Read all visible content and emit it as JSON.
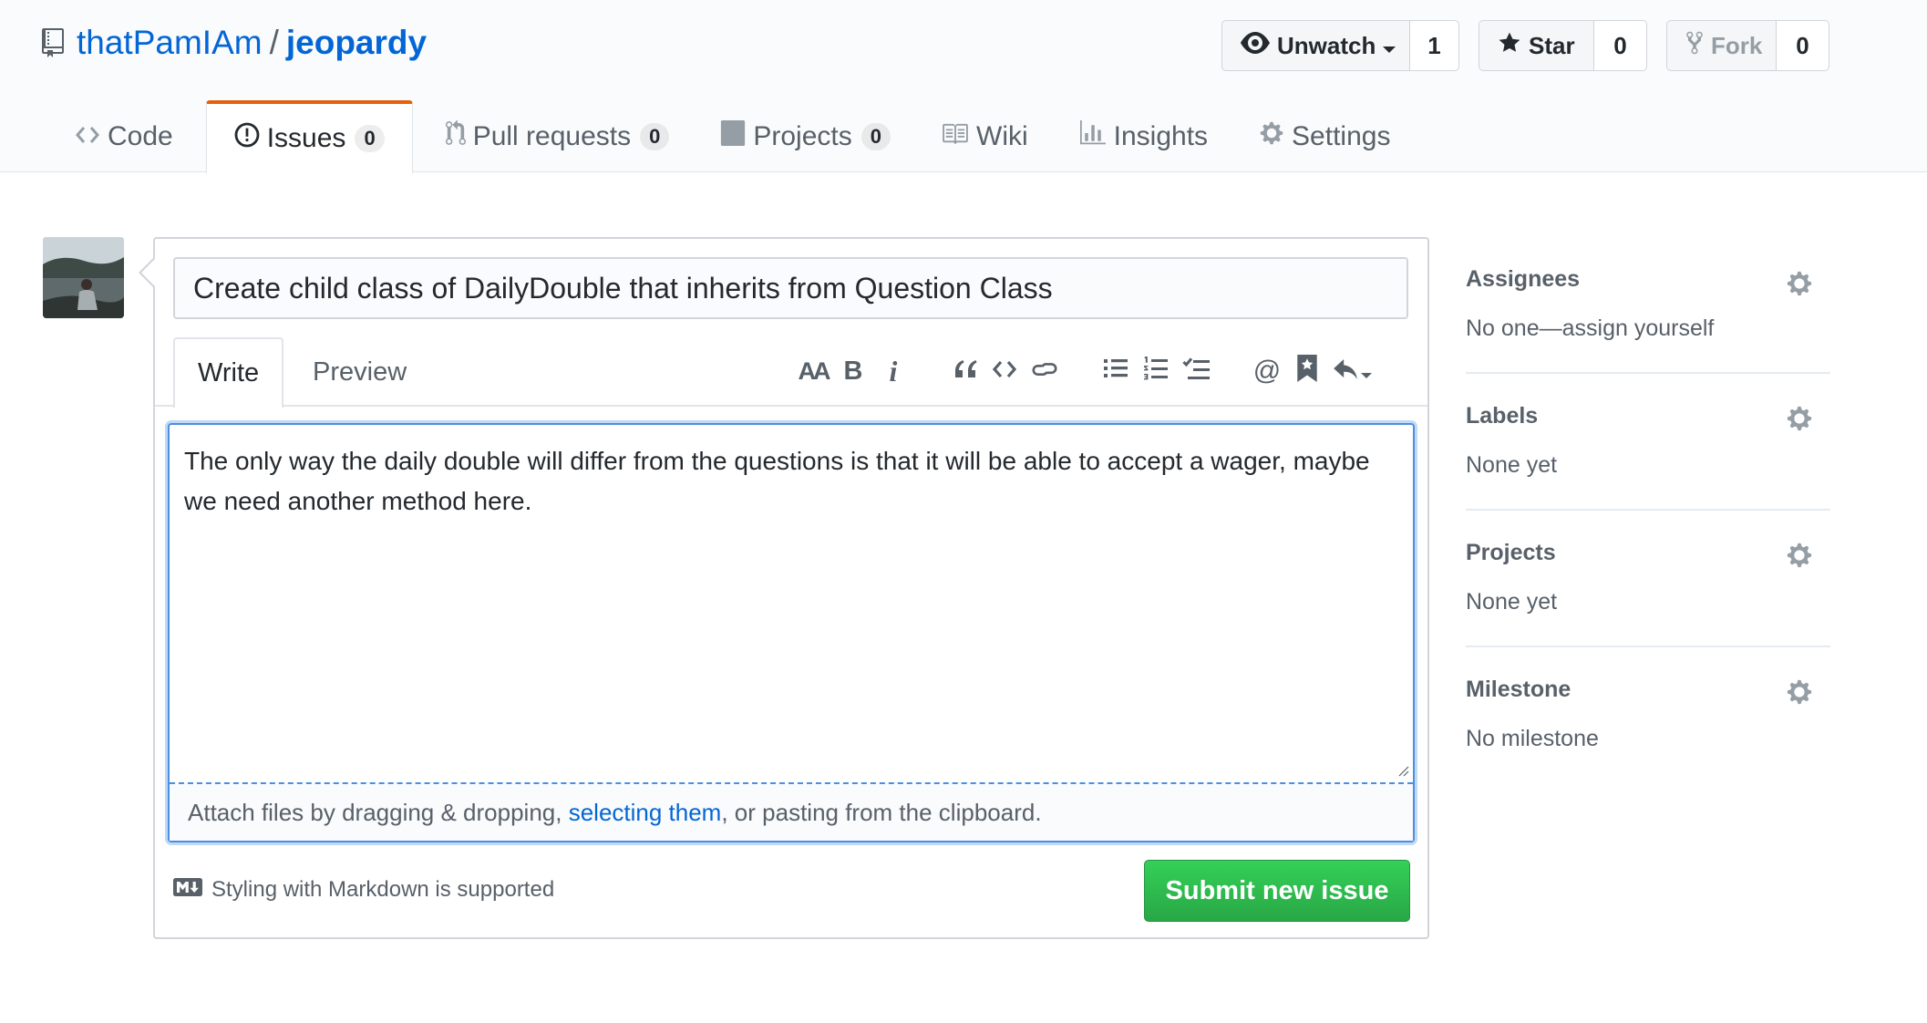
{
  "repo": {
    "owner": "thatPamIAm",
    "separator": "/",
    "name": "jeopardy"
  },
  "actions": {
    "unwatch_label": "Unwatch",
    "unwatch_count": "1",
    "star_label": "Star",
    "star_count": "0",
    "fork_label": "Fork",
    "fork_count": "0"
  },
  "nav": {
    "code": "Code",
    "issues": "Issues",
    "issues_count": "0",
    "pulls": "Pull requests",
    "pulls_count": "0",
    "projects": "Projects",
    "projects_count": "0",
    "wiki": "Wiki",
    "insights": "Insights",
    "settings": "Settings"
  },
  "form": {
    "title_value": "Create child class of DailyDouble that inherits from Question Class",
    "tab_write": "Write",
    "tab_preview": "Preview",
    "toolbar": {
      "header": "AA",
      "bold": "B",
      "italic": "i"
    },
    "body_value": "The only way the daily double will differ from the questions is that it will be able to accept a wager, maybe we need another method here.",
    "attach_prefix": "Attach files by dragging & dropping, ",
    "attach_link": "selecting them",
    "attach_suffix": ", or pasting from the clipboard.",
    "markdown_note": "Styling with Markdown is supported",
    "submit_label": "Submit new issue"
  },
  "sidebar": {
    "assignees_heading": "Assignees",
    "assignees_value": "No one—assign yourself",
    "labels_heading": "Labels",
    "labels_value": "None yet",
    "projects_heading": "Projects",
    "projects_value": "None yet",
    "milestone_heading": "Milestone",
    "milestone_value": "No milestone"
  },
  "colors": {
    "link": "#0366d6",
    "selected_tab_accent": "#e36209",
    "submit_green": "#28a745",
    "focus_blue": "#4a90e2"
  }
}
